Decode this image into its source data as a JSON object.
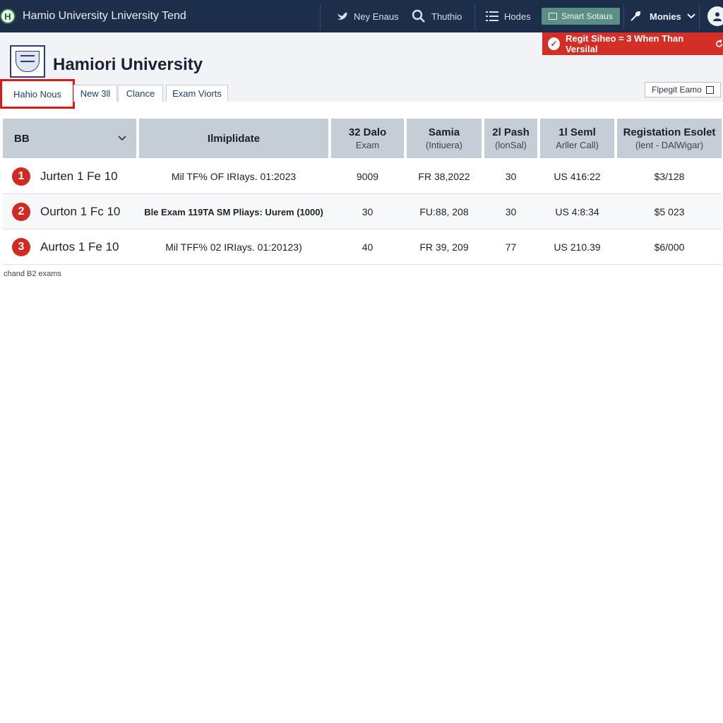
{
  "topbar": {
    "app_title": "Hamio University Lniversity Tend",
    "logo_letter": "H",
    "nav": [
      {
        "label": "Ney Enaus",
        "icon": "bird-icon"
      },
      {
        "label": "Thuthio",
        "icon": "search-icon"
      },
      {
        "label": "Hodes",
        "icon": "list-icon"
      }
    ],
    "smart_button": "Smart Sotaus",
    "menu_label": "Monies"
  },
  "header": {
    "university_name": "Hamiori University",
    "alert_text": "Regit Siheo = 3 When Than Versilal",
    "tabs": [
      "Hahio Nous",
      "New 3ll",
      "Clance",
      "Exam Viorts"
    ],
    "export_label": "Flpegit Eamo"
  },
  "table": {
    "columns": [
      {
        "l1": "BB",
        "l2": ""
      },
      {
        "l1": "Ilmiplidate",
        "l2": ""
      },
      {
        "l1": "32 Dalo",
        "l2": "Exam"
      },
      {
        "l1": "Samia",
        "l2": "(Intiuera)"
      },
      {
        "l1": "2l Pash",
        "l2": "(lonSal)"
      },
      {
        "l1": "1l Seml",
        "l2": "Arller Call)"
      },
      {
        "l1": "Registation Esolet",
        "l2": "(lent - DAlWigar)"
      }
    ],
    "rows": [
      {
        "num": "1",
        "name": "Jurten 1 Fe 10",
        "exam": "Mil TF% OF IRIays. 01:2023",
        "c3": "9009",
        "c4": "FR 38,2022",
        "c5": "30",
        "c6": "US 416:22",
        "c7": "$3/128"
      },
      {
        "num": "2",
        "name": "Ourton 1 Fc 10",
        "exam": "Ble Exam 119TA SM Pliays: Uurem (1000)",
        "c3": "30",
        "c4": "FU:88, 208",
        "c5": "30",
        "c6": "US 4:8:34",
        "c7": "$5 023"
      },
      {
        "num": "3",
        "name": "Aurtos 1 Fe 10",
        "exam": "Mil TFF% 02 IRIays. 01:20123)",
        "c3": "40",
        "c4": "FR 39, 209",
        "c5": "77",
        "c6": "US 210.39",
        "c7": "$6/000"
      }
    ],
    "footnote": "chand B2 exams"
  },
  "colors": {
    "topbar_bg": "#1c2e4a",
    "alert_red": "#d42f27",
    "smart_button_bg": "#5b8f86",
    "header_bg": "#f1f3f6",
    "table_header_bg": "#c5cdd6"
  }
}
